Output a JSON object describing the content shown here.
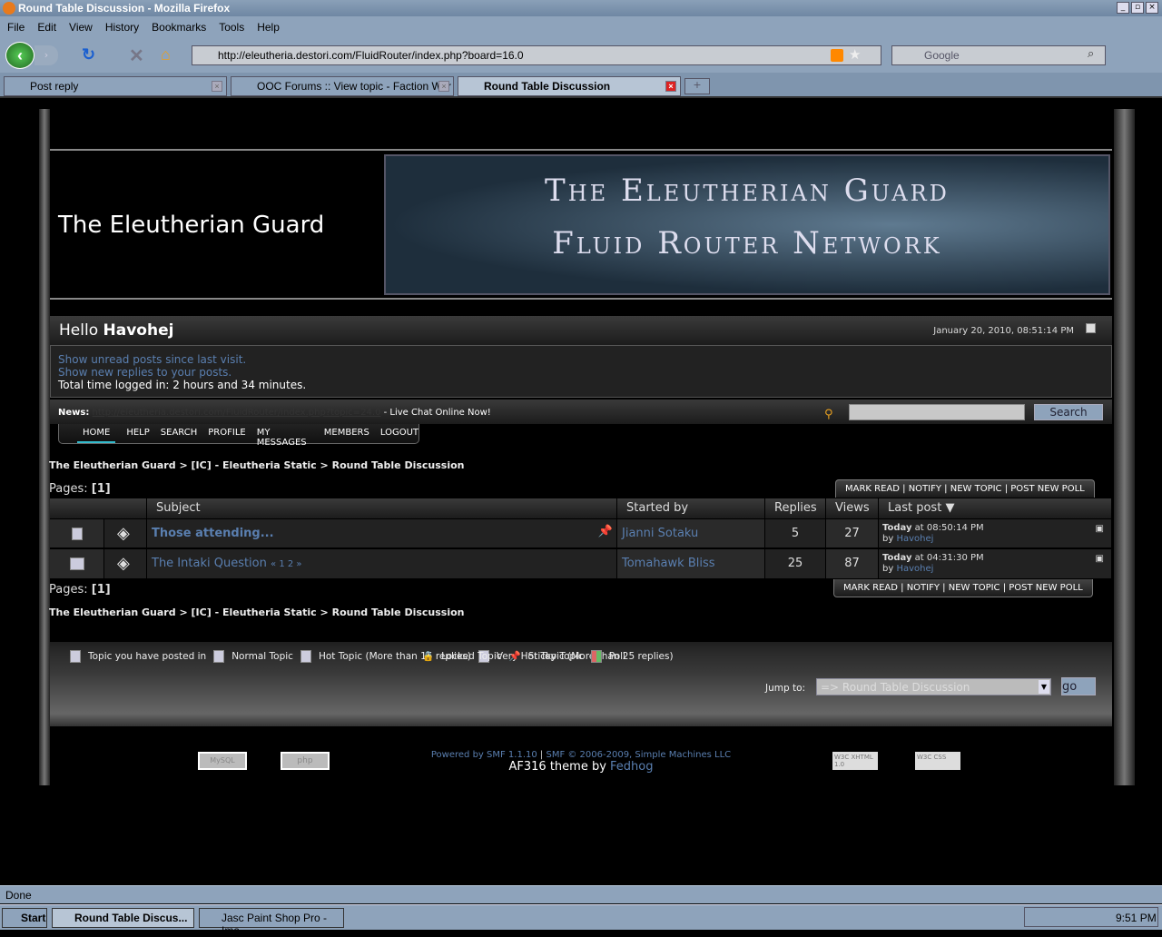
{
  "browser": {
    "window_title": "Round Table Discussion - Mozilla Firefox",
    "menu": [
      "File",
      "Edit",
      "View",
      "History",
      "Bookmarks",
      "Tools",
      "Help"
    ],
    "url": "http://eleutheria.destori.com/FluidRouter/index.php?board=16.0",
    "search_placeholder": "Google",
    "tabs": [
      {
        "label": "Post reply"
      },
      {
        "label": "OOC Forums :: View topic - Faction War ..."
      },
      {
        "label": "Round Table Discussion"
      }
    ],
    "status": "Done"
  },
  "site": {
    "title": "The Eleutherian Guard",
    "banner_line1": "The Eleutherian Guard",
    "banner_line2": "Fluid Router Network",
    "hello": "Hello",
    "username": "Havohej",
    "datetime": "January 20, 2010, 08:51:14 PM",
    "unread_link": "Show unread posts since last visit.",
    "replies_link": "Show new replies to your posts.",
    "time_logged": "Total time logged in: 2 hours and 34 minutes.",
    "news_label": "News:",
    "news_link": "http://eleutheria.destori.com/FluidRouter/index.php?topic=24.0",
    "news_text": " - Live Chat Online Now!",
    "search_button": "Search",
    "nav": [
      "HOME",
      "HELP",
      "SEARCH",
      "PROFILE",
      "MY MESSAGES",
      "MEMBERS",
      "LOGOUT"
    ]
  },
  "breadcrumb": [
    "The Eleutherian Guard",
    "[IC] - Eleutheria Static",
    "Round Table Discussion"
  ],
  "breadcrumb_sep": ">",
  "pages_label": "Pages:",
  "pages_current": "[1]",
  "actions": [
    "MARK READ",
    "NOTIFY",
    "NEW TOPIC",
    "POST NEW POLL"
  ],
  "table": {
    "headers": {
      "subject": "Subject",
      "started_by": "Started by",
      "replies": "Replies",
      "views": "Views",
      "last_post": "Last post"
    },
    "rows": [
      {
        "subject": "Those attending...",
        "pages": "",
        "starter": "Jianni Sotaku",
        "replies": "5",
        "views": "27",
        "last_day": "Today",
        "last_time": " at 08:50:14 PM",
        "by": "by",
        "last_by": "Havohej",
        "sticky": true
      },
      {
        "subject": "The Intaki Question",
        "pages": "« 1 2 »",
        "starter": "Tomahawk Bliss",
        "replies": "25",
        "views": "87",
        "last_day": "Today",
        "last_time": " at 04:31:30 PM",
        "by": "by",
        "last_by": "Havohej",
        "sticky": false
      }
    ]
  },
  "legend": {
    "left": [
      "Topic you have posted in",
      "Normal Topic",
      "Hot Topic (More than 15 replies)",
      "Very Hot Topic (More than 25 replies)"
    ],
    "right": [
      "Locked Topic",
      "Sticky Topic",
      "Poll"
    ]
  },
  "jump": {
    "label": "Jump to:",
    "value": "=> Round Table Discussion",
    "go": "go"
  },
  "footer": {
    "powered": "Powered by SMF 1.1.10",
    "sep": " | ",
    "copyright": "SMF © 2006-2009, Simple Machines LLC",
    "theme": "AF316 theme by ",
    "theme_author": "Fedhog",
    "badges": [
      "MySQL",
      "php",
      "W3C XHTML 1.0",
      "W3C CSS"
    ]
  },
  "taskbar": {
    "start": "Start",
    "items": [
      "Round Table Discus...",
      "Jasc Paint Shop Pro - Ima..."
    ],
    "clock": "9:51 PM"
  },
  "colors": {
    "link": "#5a7fb0",
    "bg": "#000000",
    "chrome": "#8ea3bb"
  }
}
